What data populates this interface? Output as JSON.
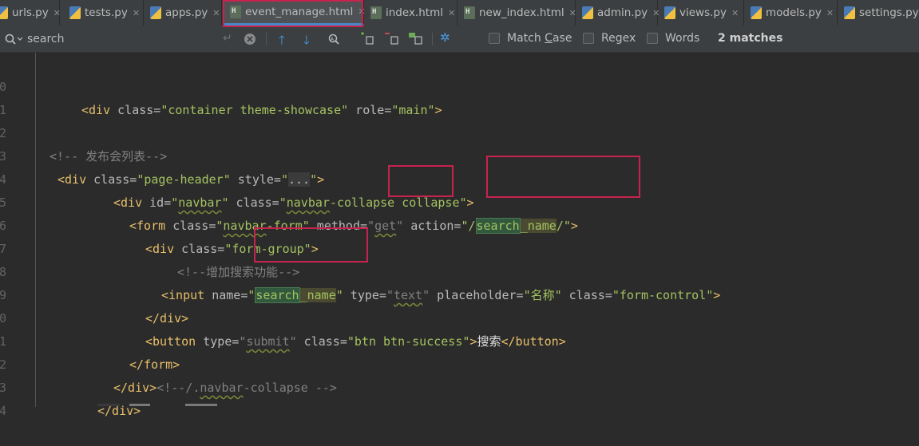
{
  "tabs": [
    {
      "label": "urls.py",
      "type": "py"
    },
    {
      "label": "tests.py",
      "type": "py"
    },
    {
      "label": "apps.py",
      "type": "py"
    },
    {
      "label": "event_manage.html",
      "type": "html",
      "active": true
    },
    {
      "label": "index.html",
      "type": "html"
    },
    {
      "label": "new_index.html",
      "type": "html"
    },
    {
      "label": "admin.py",
      "type": "py"
    },
    {
      "label": "views.py",
      "type": "py"
    },
    {
      "label": "models.py",
      "type": "py"
    },
    {
      "label": "settings.py",
      "type": "py"
    }
  ],
  "search": {
    "query": "search",
    "match_case_label": "Match Case",
    "match_case_underline": "C",
    "regex_label": "Regex",
    "words_label": "Words",
    "match_count": "2 matches"
  },
  "code": {
    "line_numbers": [
      "0",
      "1",
      "2",
      "3",
      "4",
      "5",
      "6",
      "7",
      "8",
      "9",
      "0",
      "1",
      "2",
      "3",
      "4"
    ],
    "l0": {
      "tag_open": "<div ",
      "attr1": "class=",
      "val1": "\"container theme-showcase\"",
      "attr2": " role=",
      "val2": "\"main\"",
      "tag_close": ">"
    },
    "l2": {
      "comment": "<!-- 发布会列表-->"
    },
    "l3": {
      "tag_open": "<div ",
      "attr1": "class=",
      "val1": "\"page-header\"",
      "attr2": " style=",
      "q1": "\"",
      "fold": "...",
      "q2": "\"",
      "tag_close": ">"
    },
    "l4": {
      "tag_open": "<div ",
      "attr1": "id=",
      "val1a": "\"",
      "val1b": "navbar",
      "val1c": "\"",
      "attr2": " class=",
      "val2a": "\"",
      "val2b": "navbar",
      "val2c": "-collapse collapse\"",
      "tag_close": ">"
    },
    "l5": {
      "tag_open": "<form ",
      "attr1": "class=",
      "val1a": "\"",
      "val1b": "navbar",
      "val1c": "-form\"",
      "attr2": " method=",
      "val2a": "\"",
      "val2b": "get",
      "val2c": "\"",
      "attr3": " action=",
      "val3a": "\"/",
      "val3b": "search",
      "val3c": "_name",
      "val3d": "/\"",
      "tag_close": ">"
    },
    "l6": {
      "tag_open": "<div ",
      "attr1": "class=",
      "val1": "\"form-group\"",
      "tag_close": ">"
    },
    "l7": {
      "comment": "<!--增加搜索功能-->"
    },
    "l8": {
      "tag_open": "<input ",
      "attr1": "name=",
      "q1": "\"",
      "hl": "search",
      "hl2": "_name",
      "q2": "\"",
      "attr2": " type=",
      "val2a": "\"",
      "val2b": "text",
      "val2c": "\"",
      "attr3": " placeholder=",
      "val3": "\"名称\"",
      "attr4": " class=",
      "val4": "\"form-control\"",
      "tag_close": ">"
    },
    "l9": {
      "tag": "</div>"
    },
    "l10": {
      "tag_open": "<button ",
      "attr1": "type=",
      "val1a": "\"",
      "val1b": "submit",
      "val1c": "\"",
      "attr2": " class=",
      "val2": "\"btn btn-success\"",
      "tag_mid": ">",
      "text": "搜索",
      "tag_close": "</button>"
    },
    "l11": {
      "tag": "</form>"
    },
    "l12": {
      "tag": "</div>",
      "comment1": "<!--/.",
      "comment2": "navbar",
      "comment3": "-collapse -->"
    },
    "l13": {
      "tag": "</div>"
    }
  }
}
